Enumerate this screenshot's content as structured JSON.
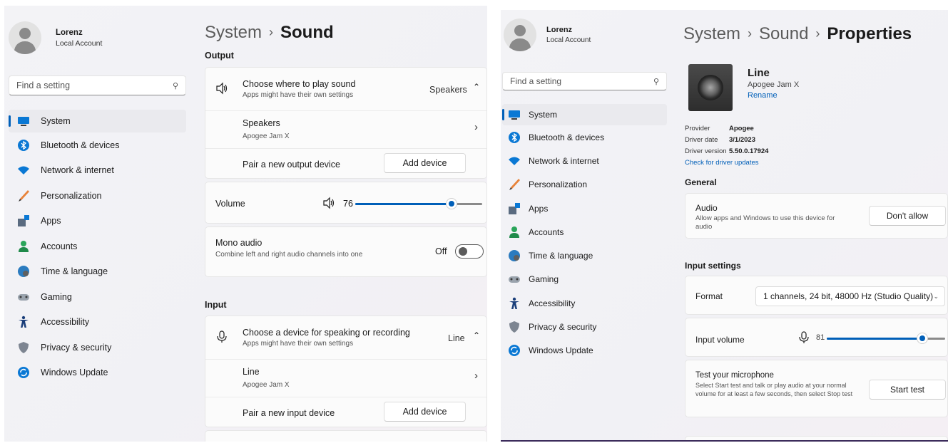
{
  "left": {
    "user": {
      "name": "Lorenz",
      "type": "Local Account"
    },
    "search": {
      "placeholder": "Find a setting"
    },
    "nav": [
      {
        "label": "System",
        "icon": "monitor-icon"
      },
      {
        "label": "Bluetooth & devices",
        "icon": "bluetooth-icon"
      },
      {
        "label": "Network & internet",
        "icon": "wifi-icon"
      },
      {
        "label": "Personalization",
        "icon": "brush-icon"
      },
      {
        "label": "Apps",
        "icon": "apps-icon"
      },
      {
        "label": "Accounts",
        "icon": "person-icon"
      },
      {
        "label": "Time & language",
        "icon": "globe-clock-icon"
      },
      {
        "label": "Gaming",
        "icon": "gamepad-icon"
      },
      {
        "label": "Accessibility",
        "icon": "accessibility-icon"
      },
      {
        "label": "Privacy & security",
        "icon": "shield-icon"
      },
      {
        "label": "Windows Update",
        "icon": "update-icon"
      }
    ],
    "breadcrumb": {
      "parent": "System",
      "sep": "›",
      "current": "Sound"
    },
    "output": {
      "section": "Output",
      "choose_title": "Choose where to play sound",
      "choose_sub": "Apps might have their own settings",
      "choose_value": "Speakers",
      "device_name": "Speakers",
      "device_sub": "Apogee Jam X",
      "pair_label": "Pair a new output device",
      "add_button": "Add device",
      "volume_label": "Volume",
      "volume_value": "76",
      "volume_fraction": 0.76,
      "mono_title": "Mono audio",
      "mono_sub": "Combine left and right audio channels into one",
      "mono_state": "Off"
    },
    "input": {
      "section": "Input",
      "choose_title": "Choose a device for speaking or recording",
      "choose_sub": "Apps might have their own settings",
      "choose_value": "Line",
      "device_name": "Line",
      "device_sub": "Apogee Jam X",
      "pair_label": "Pair a new input device",
      "add_button": "Add device"
    }
  },
  "right": {
    "user": {
      "name": "Lorenz",
      "type": "Local Account"
    },
    "search": {
      "placeholder": "Find a setting"
    },
    "nav": [
      {
        "label": "System",
        "icon": "monitor-icon"
      },
      {
        "label": "Bluetooth & devices",
        "icon": "bluetooth-icon"
      },
      {
        "label": "Network & internet",
        "icon": "wifi-icon"
      },
      {
        "label": "Personalization",
        "icon": "brush-icon"
      },
      {
        "label": "Apps",
        "icon": "apps-icon"
      },
      {
        "label": "Accounts",
        "icon": "person-icon"
      },
      {
        "label": "Time & language",
        "icon": "globe-clock-icon"
      },
      {
        "label": "Gaming",
        "icon": "gamepad-icon"
      },
      {
        "label": "Accessibility",
        "icon": "accessibility-icon"
      },
      {
        "label": "Privacy & security",
        "icon": "shield-icon"
      },
      {
        "label": "Windows Update",
        "icon": "update-icon"
      }
    ],
    "breadcrumb": {
      "parent": "System",
      "sep1": "›",
      "middle": "Sound",
      "sep2": "›",
      "current": "Properties"
    },
    "device": {
      "name": "Line",
      "sub": "Apogee Jam X",
      "rename": "Rename",
      "provider_label": "Provider",
      "provider": "Apogee",
      "date_label": "Driver date",
      "date": "3/1/2023",
      "version_label": "Driver version",
      "version": "5.50.0.17924",
      "check_updates": "Check for driver updates"
    },
    "general": {
      "section": "General",
      "audio_title": "Audio",
      "audio_sub": "Allow apps and Windows to use this device for audio",
      "audio_button": "Don't allow"
    },
    "input_settings": {
      "section": "Input settings",
      "format_label": "Format",
      "format_value": "1 channels, 24 bit, 48000 Hz (Studio Quality)",
      "volume_label": "Input volume",
      "volume_value": "81",
      "volume_fraction": 0.81,
      "test_title": "Test your microphone",
      "test_sub": "Select Start test and talk or play audio at your normal volume for at least a few seconds, then select Stop test",
      "test_button": "Start test"
    }
  },
  "colors": {
    "accent": "#005fb8",
    "background": "#f3f3f6"
  }
}
